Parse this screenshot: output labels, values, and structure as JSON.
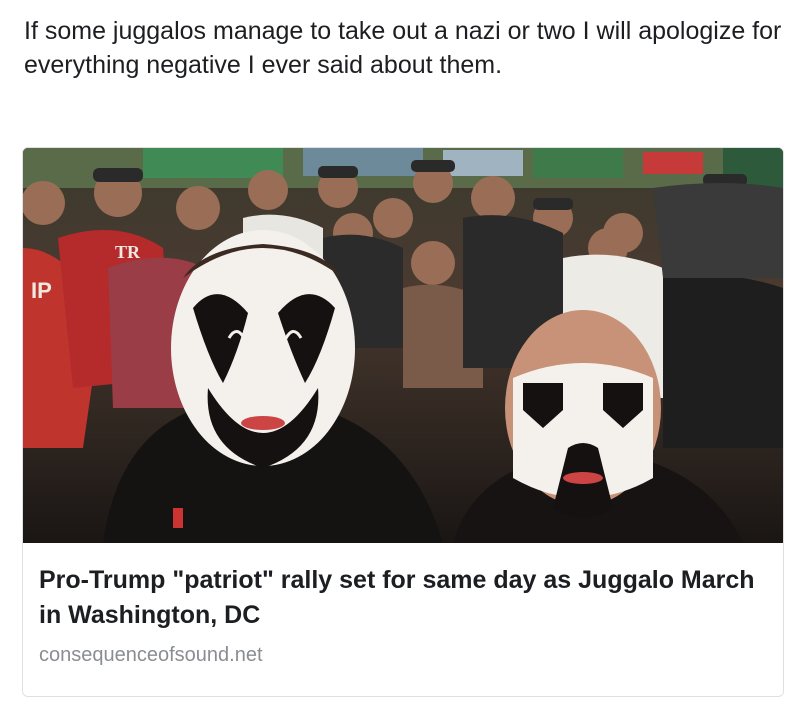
{
  "post": {
    "text": "If some juggalos manage to take out a nazi or two I will apologize for everything negative I ever said about them."
  },
  "link_card": {
    "image_icon": "photo-of-juggalos-in-face-paint-at-bar",
    "headline": "Pro-Trump \"patriot\" rally set for same day as Juggalo March in Washington, DC",
    "domain": "consequenceofsound.net"
  },
  "colors": {
    "text_primary": "#1c1e21",
    "text_secondary": "#8a8d91",
    "card_border": "#dddfe2",
    "shirt_red": "#b52a2a",
    "face_paint_white": "#f4f1ec",
    "face_paint_black": "#141110"
  }
}
